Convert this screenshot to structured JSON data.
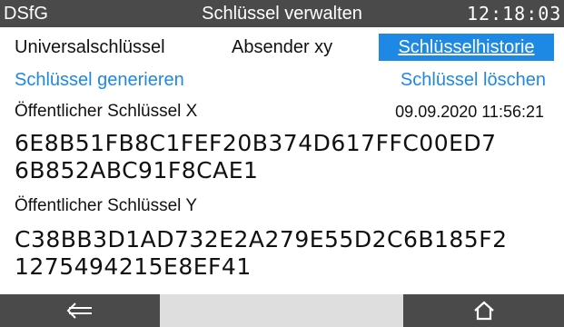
{
  "titlebar": {
    "brand": "DSfG",
    "title": "Schlüssel verwalten",
    "clock": "12:18:03"
  },
  "tabs": {
    "universal": "Universalschlüssel",
    "sender": "Absender xy",
    "history": "Schlüsselhistorie"
  },
  "actions": {
    "generate": "Schlüssel generieren",
    "delete": "Schlüssel löschen"
  },
  "key_x": {
    "label": "Öffentlicher Schlüssel X",
    "date": "09.09.2020 11:56:21",
    "line1": "6E8B51FB8C1FEF20B374D617FFC00ED7",
    "line2": "6B852ABC91F8CAE1"
  },
  "key_y": {
    "label": "Öffentlicher Schlüssel Y",
    "line1": "C38BB3D1AD732E2A279E55D2C6B185F2",
    "line2": "1275494215E8EF41"
  },
  "bottombar": {
    "back_icon": "arrow-left-icon",
    "home_icon": "home-icon"
  },
  "colors": {
    "titlebar_bg": "#4a4a4a",
    "accent": "#1e88e5",
    "bottom_spacer": "#dedede"
  }
}
